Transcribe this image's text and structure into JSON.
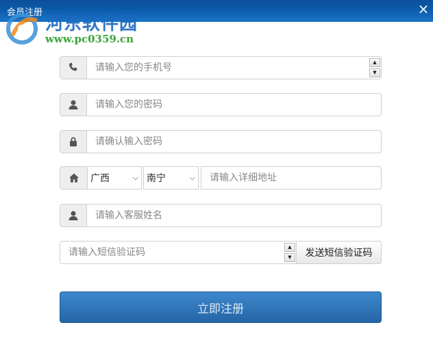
{
  "window": {
    "title": "会员注册",
    "close_label": "×"
  },
  "watermark": {
    "title": "河东软件园",
    "url": "www.pc0359.cn"
  },
  "form": {
    "phone_placeholder": "请输入您的手机号",
    "password_placeholder": "请输入您的密码",
    "confirm_placeholder": "请确认输入密码",
    "province_value": "广西",
    "city_value": "南宁",
    "address_placeholder": "请输入详细地址",
    "service_name_placeholder": "请输入客服姓名",
    "sms_code_placeholder": "请输入短信验证码",
    "send_sms_label": "发送短信验证码",
    "submit_label": "立即注册"
  },
  "icons": {
    "phone": "phone-icon",
    "user": "user-icon",
    "lock": "lock-icon",
    "home": "home-icon",
    "spin_up": "▲",
    "spin_down": "▼",
    "select_arrow": "⌵"
  },
  "colors": {
    "titlebar": "#0d4f9a",
    "submit_button": "#2f76bb",
    "watermark_text": "#1b67c0",
    "watermark_url": "#3aa33a"
  }
}
